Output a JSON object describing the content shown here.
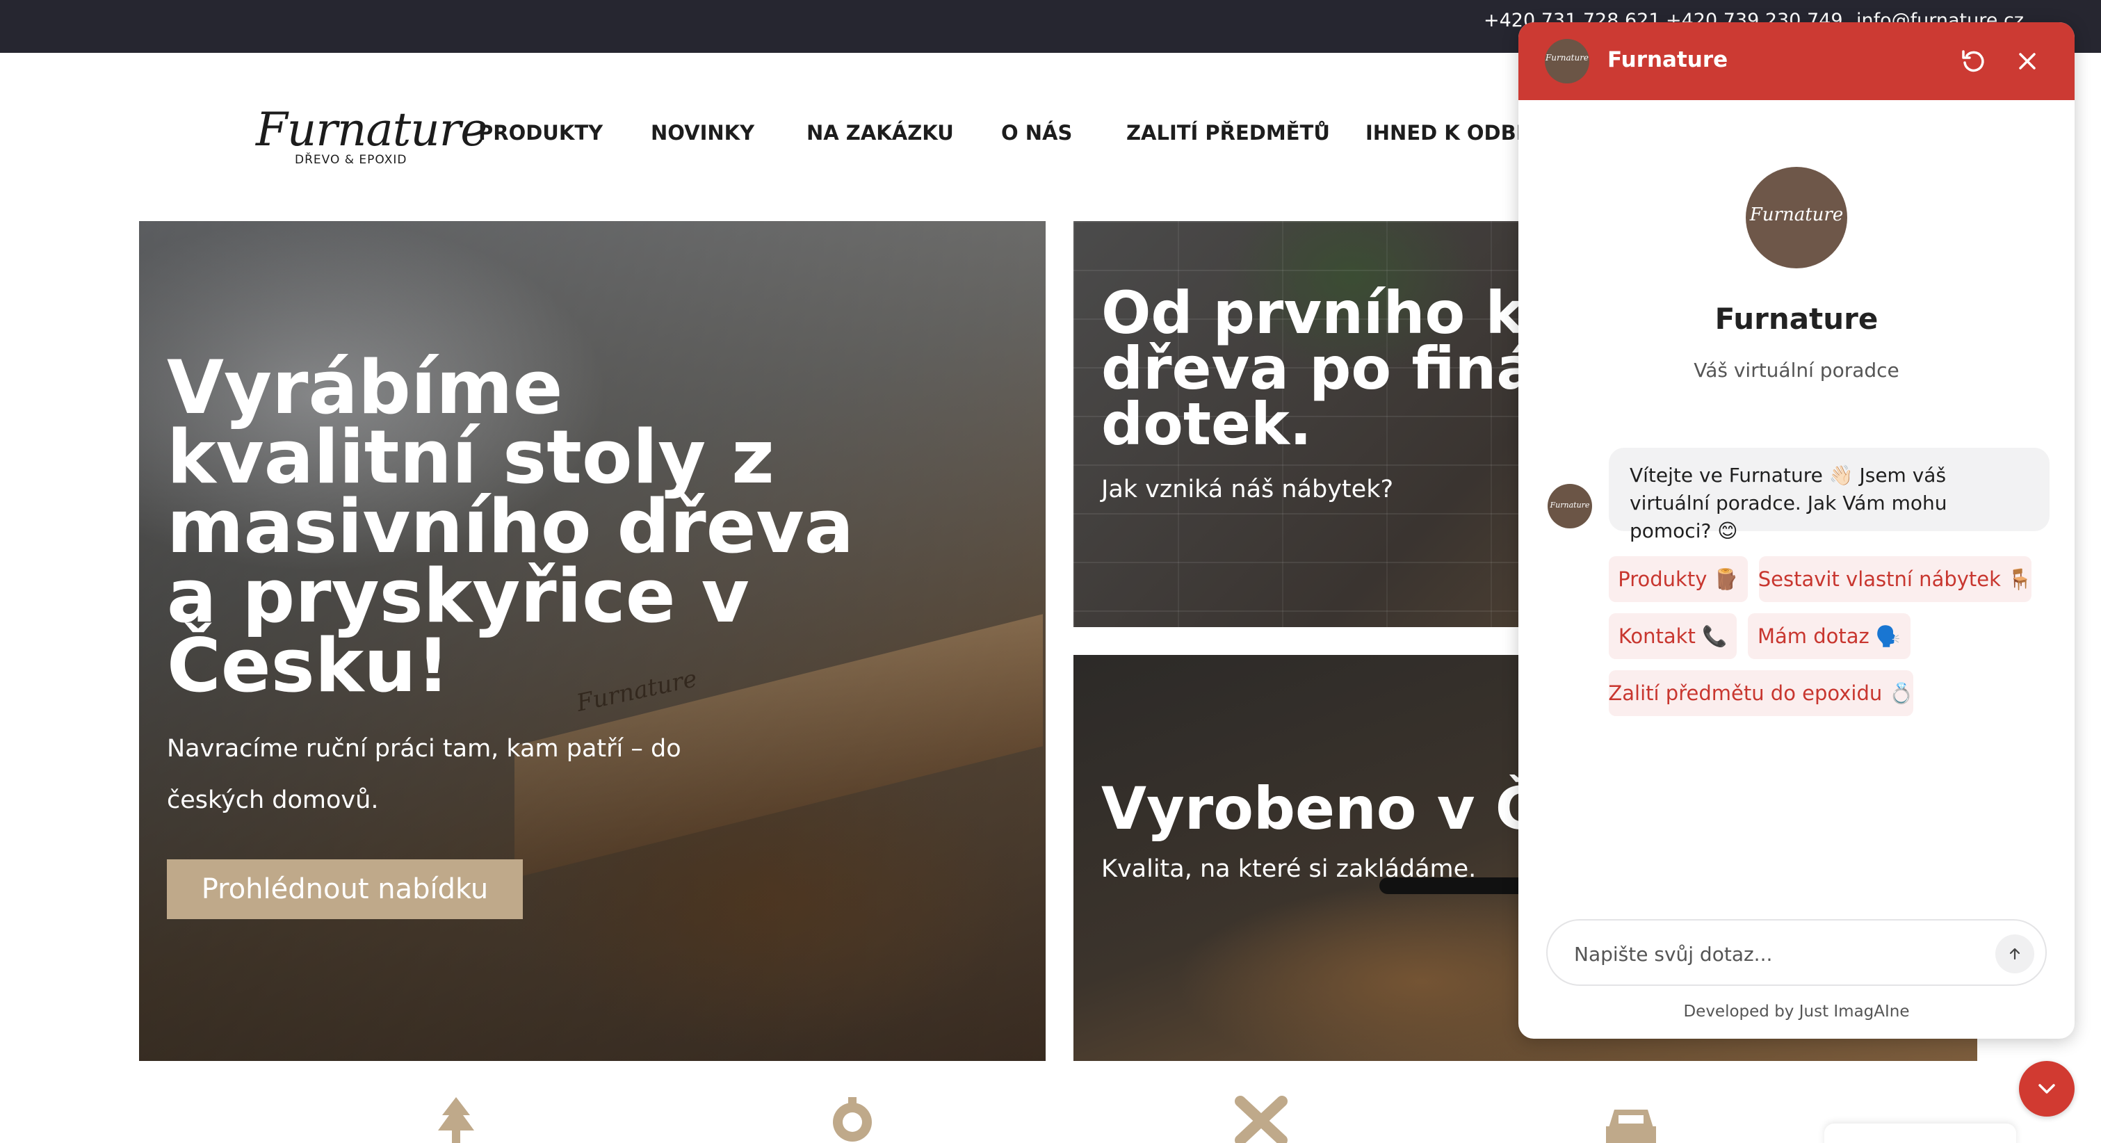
{
  "topbar": {
    "phone1": "+420 731 728 621",
    "phone2": "+420 739 230 749",
    "email": "info@furnature.cz"
  },
  "logo": {
    "brand": "Furnature",
    "tagline": "DŘEVO & EPOXID"
  },
  "nav": {
    "items": [
      "PRODUKTY",
      "NOVINKY",
      "NA ZAKÁZKU",
      "O NÁS",
      "ZALITÍ PŘEDMĚTŮ",
      "IHNED K ODBĚR"
    ]
  },
  "hero": {
    "main": {
      "title": "Vyrábíme kvalitní stoly z masivního dřeva a pryskyřice v Česku!",
      "text": "Navracíme ruční práci tam, kam patří – do českých domovů.",
      "button": "Prohlédnout nabídku",
      "engraving": "Furnature"
    },
    "top": {
      "title_line1": "Od prvního kus",
      "title_line2": "dřeva po finální",
      "title_line3": "dotek.",
      "subtitle": "Jak vzniká náš nábytek?"
    },
    "bottom": {
      "title": "Vyrobeno v Čes",
      "subtitle": "Kvalita, na které si zakládáme."
    }
  },
  "features": {
    "icons": [
      "tree-icon",
      "gear-icon",
      "tools-icon",
      "car-icon"
    ],
    "color": "#bfa98a"
  },
  "chat": {
    "header_name": "Furnature",
    "avatar_text": "Furnature",
    "profile_name": "Furnature",
    "profile_role": "Váš virtuální poradce",
    "message": "Vítejte ve Furnature 👋🏻 Jsem váš virtuální poradce. Jak Vám mohu pomoci? 😊",
    "chips": [
      "Produkty 🪵",
      "Sestavit vlastní nábytek 🪑",
      "Kontakt 📞",
      "Mám dotaz 🗣️",
      "Zalití předmětu do epoxidu 💍"
    ],
    "input_placeholder": "Napište svůj dotaz...",
    "developed_by": "Developed by Just ImagAIne"
  },
  "colors": {
    "accent_red": "#cc3a33",
    "chip_bg": "#fbeeee",
    "button_gold": "#bfa98a",
    "topbar_dark": "#262630"
  }
}
